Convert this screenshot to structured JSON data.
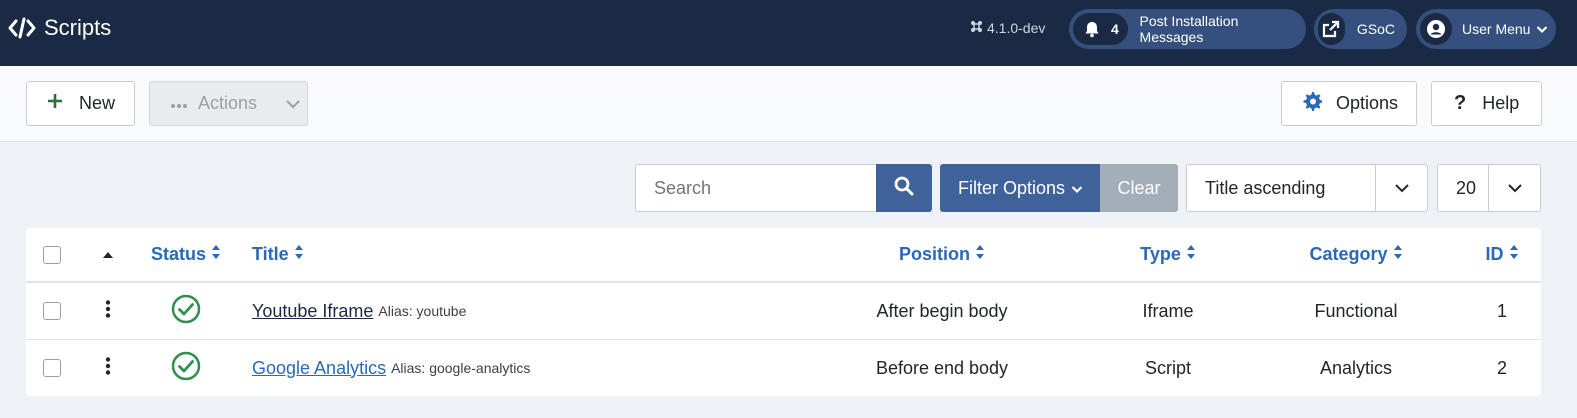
{
  "header": {
    "title": "Scripts",
    "version": "4.1.0-dev",
    "post_install": {
      "count": "4",
      "label": "Post Installation Messages"
    },
    "site_link": "GSoC",
    "user_menu": "User Menu"
  },
  "toolbar": {
    "new_label": "New",
    "actions_label": "Actions",
    "options_label": "Options",
    "help_label": "Help"
  },
  "filters": {
    "search_placeholder": "Search",
    "filter_options_label": "Filter Options",
    "clear_label": "Clear",
    "ordering_selected": "Title ascending",
    "limit_selected": "20"
  },
  "table": {
    "columns": {
      "status": "Status",
      "title": "Title",
      "position": "Position",
      "type": "Type",
      "category": "Category",
      "id": "ID"
    },
    "rows": [
      {
        "title": "Youtube Iframe",
        "alias": "Alias: youtube",
        "position": "After begin body",
        "type": "Iframe",
        "category": "Functional",
        "id": "1",
        "status": "published"
      },
      {
        "title": "Google Analytics",
        "alias": "Alias: google-analytics",
        "position": "Before end body",
        "type": "Script",
        "category": "Analytics",
        "id": "2",
        "status": "published"
      }
    ]
  },
  "colors": {
    "header_bg": "#1a2a44",
    "pill_bg": "#35507e",
    "primary": "#3f629a",
    "link": "#2a69b8",
    "published_green": "#2f8f4e"
  }
}
